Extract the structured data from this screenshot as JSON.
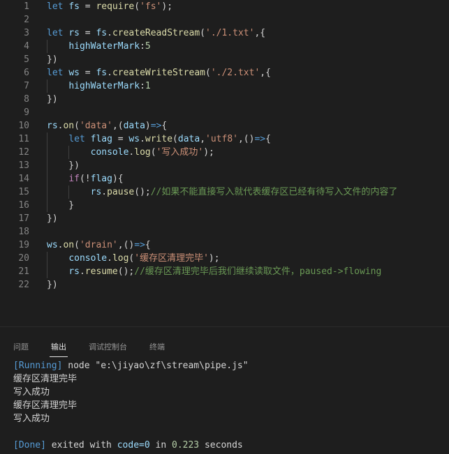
{
  "editor": {
    "line_numbers": [
      "1",
      "2",
      "3",
      "4",
      "5",
      "6",
      "7",
      "8",
      "9",
      "10",
      "11",
      "12",
      "13",
      "14",
      "15",
      "16",
      "17",
      "18",
      "19",
      "20",
      "21",
      "22"
    ],
    "lines": [
      [
        {
          "t": "let",
          "c": "k"
        },
        {
          "t": " ",
          "c": "p"
        },
        {
          "t": "fs",
          "c": "v"
        },
        {
          "t": " = ",
          "c": "p"
        },
        {
          "t": "require",
          "c": "f"
        },
        {
          "t": "(",
          "c": "p"
        },
        {
          "t": "'fs'",
          "c": "s"
        },
        {
          "t": ");",
          "c": "p"
        }
      ],
      [],
      [
        {
          "t": "let",
          "c": "k"
        },
        {
          "t": " ",
          "c": "p"
        },
        {
          "t": "rs",
          "c": "v"
        },
        {
          "t": " = ",
          "c": "p"
        },
        {
          "t": "fs",
          "c": "v"
        },
        {
          "t": ".",
          "c": "p"
        },
        {
          "t": "createReadStream",
          "c": "f"
        },
        {
          "t": "(",
          "c": "p"
        },
        {
          "t": "'./1.txt'",
          "c": "s"
        },
        {
          "t": ",{",
          "c": "p"
        }
      ],
      [
        {
          "t": "    ",
          "c": "p"
        },
        {
          "t": "highWaterMark",
          "c": "v"
        },
        {
          "t": ":",
          "c": "p"
        },
        {
          "t": "5",
          "c": "n"
        }
      ],
      [
        {
          "t": "})",
          "c": "p"
        }
      ],
      [
        {
          "t": "let",
          "c": "k"
        },
        {
          "t": " ",
          "c": "p"
        },
        {
          "t": "ws",
          "c": "v"
        },
        {
          "t": " = ",
          "c": "p"
        },
        {
          "t": "fs",
          "c": "v"
        },
        {
          "t": ".",
          "c": "p"
        },
        {
          "t": "createWriteStream",
          "c": "f"
        },
        {
          "t": "(",
          "c": "p"
        },
        {
          "t": "'./2.txt'",
          "c": "s"
        },
        {
          "t": ",{",
          "c": "p"
        }
      ],
      [
        {
          "t": "    ",
          "c": "p"
        },
        {
          "t": "highWaterMark",
          "c": "v"
        },
        {
          "t": ":",
          "c": "p"
        },
        {
          "t": "1",
          "c": "n"
        }
      ],
      [
        {
          "t": "})",
          "c": "p"
        }
      ],
      [],
      [
        {
          "t": "rs",
          "c": "v"
        },
        {
          "t": ".",
          "c": "p"
        },
        {
          "t": "on",
          "c": "f"
        },
        {
          "t": "(",
          "c": "p"
        },
        {
          "t": "'data'",
          "c": "s"
        },
        {
          "t": ",(",
          "c": "p"
        },
        {
          "t": "data",
          "c": "v"
        },
        {
          "t": ")",
          "c": "p"
        },
        {
          "t": "=>",
          "c": "k"
        },
        {
          "t": "{",
          "c": "p"
        }
      ],
      [
        {
          "t": "    ",
          "c": "p"
        },
        {
          "t": "let",
          "c": "k"
        },
        {
          "t": " ",
          "c": "p"
        },
        {
          "t": "flag",
          "c": "v"
        },
        {
          "t": " = ",
          "c": "p"
        },
        {
          "t": "ws",
          "c": "v"
        },
        {
          "t": ".",
          "c": "p"
        },
        {
          "t": "write",
          "c": "f"
        },
        {
          "t": "(",
          "c": "p"
        },
        {
          "t": "data",
          "c": "v"
        },
        {
          "t": ",",
          "c": "p"
        },
        {
          "t": "'utf8'",
          "c": "s"
        },
        {
          "t": ",()",
          "c": "p"
        },
        {
          "t": "=>",
          "c": "k"
        },
        {
          "t": "{",
          "c": "p"
        }
      ],
      [
        {
          "t": "        ",
          "c": "p"
        },
        {
          "t": "console",
          "c": "v"
        },
        {
          "t": ".",
          "c": "p"
        },
        {
          "t": "log",
          "c": "f"
        },
        {
          "t": "(",
          "c": "p"
        },
        {
          "t": "'写入成功'",
          "c": "s"
        },
        {
          "t": ");",
          "c": "p"
        }
      ],
      [
        {
          "t": "    })",
          "c": "p"
        }
      ],
      [
        {
          "t": "    ",
          "c": "p"
        },
        {
          "t": "if",
          "c": "i"
        },
        {
          "t": "(!",
          "c": "p"
        },
        {
          "t": "flag",
          "c": "v"
        },
        {
          "t": "){",
          "c": "p"
        }
      ],
      [
        {
          "t": "        ",
          "c": "p"
        },
        {
          "t": "rs",
          "c": "v"
        },
        {
          "t": ".",
          "c": "p"
        },
        {
          "t": "pause",
          "c": "f"
        },
        {
          "t": "();",
          "c": "p"
        },
        {
          "t": "//如果不能直接写入就代表缓存区已经有待写入文件的内容了",
          "c": "c"
        }
      ],
      [
        {
          "t": "    }",
          "c": "p"
        }
      ],
      [
        {
          "t": "})",
          "c": "p"
        }
      ],
      [],
      [
        {
          "t": "ws",
          "c": "v"
        },
        {
          "t": ".",
          "c": "p"
        },
        {
          "t": "on",
          "c": "f"
        },
        {
          "t": "(",
          "c": "p"
        },
        {
          "t": "'drain'",
          "c": "s"
        },
        {
          "t": ",()",
          "c": "p"
        },
        {
          "t": "=>",
          "c": "k"
        },
        {
          "t": "{",
          "c": "p"
        }
      ],
      [
        {
          "t": "    ",
          "c": "p"
        },
        {
          "t": "console",
          "c": "v"
        },
        {
          "t": ".",
          "c": "p"
        },
        {
          "t": "log",
          "c": "f"
        },
        {
          "t": "(",
          "c": "p"
        },
        {
          "t": "'缓存区清理完毕'",
          "c": "s"
        },
        {
          "t": ");",
          "c": "p"
        }
      ],
      [
        {
          "t": "    ",
          "c": "p"
        },
        {
          "t": "rs",
          "c": "v"
        },
        {
          "t": ".",
          "c": "p"
        },
        {
          "t": "resume",
          "c": "f"
        },
        {
          "t": "();",
          "c": "p"
        },
        {
          "t": "//缓存区清理完毕后我们继续读取文件，paused->flowing",
          "c": "c"
        }
      ],
      [
        {
          "t": "})",
          "c": "p"
        }
      ]
    ]
  },
  "panel": {
    "tabs": [
      "问题",
      "输出",
      "调试控制台",
      "终端"
    ],
    "active_tab": "输出",
    "output": {
      "running_tag": "[Running]",
      "command": " node \"e:\\jiyao\\zf\\stream\\pipe.js\"",
      "lines": [
        "缓存区清理完毕",
        "写入成功",
        "缓存区清理完毕",
        "写入成功"
      ],
      "done_tag": "[Done]",
      "exit_prefix": " exited with ",
      "exit_code": "code=0",
      "exit_mid": " in ",
      "duration": "0.223",
      "exit_suffix": " seconds"
    }
  },
  "colors": {
    "background": "#1e1e1e",
    "keyword": "#569cd6",
    "variable": "#9cdcfe",
    "function": "#dcdcaa",
    "string": "#ce9178",
    "number": "#b5cea8",
    "comment": "#6a9955"
  }
}
